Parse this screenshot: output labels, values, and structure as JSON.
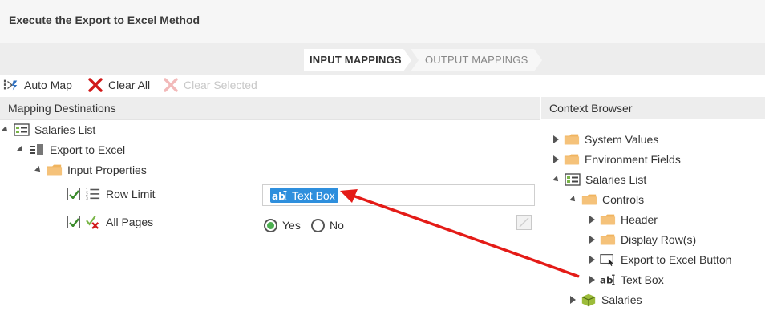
{
  "header": {
    "title": "Execute the Export to Excel Method"
  },
  "steps": [
    {
      "label": "INPUT MAPPINGS",
      "active": true
    },
    {
      "label": "OUTPUT MAPPINGS",
      "active": false
    }
  ],
  "toolbar": {
    "auto_map": "Auto Map",
    "clear_all": "Clear All",
    "clear_selected": "Clear Selected"
  },
  "mapping": {
    "heading": "Mapping Destinations",
    "root": "Salaries List",
    "method": "Export to Excel",
    "props_folder": "Input Properties",
    "row_limit": {
      "label": "Row Limit",
      "checked": true,
      "chip": "Text Box"
    },
    "all_pages": {
      "label": "All Pages",
      "checked": true,
      "yes": "Yes",
      "no": "No",
      "selected": "Yes"
    }
  },
  "context": {
    "heading": "Context Browser",
    "items": [
      {
        "label": "System Values",
        "icon": "folder-icon"
      },
      {
        "label": "Environment Fields",
        "icon": "folder-icon"
      },
      {
        "label": "Salaries List",
        "icon": "list-view-icon"
      },
      {
        "label": "Controls",
        "icon": "folder-icon"
      },
      {
        "label": "Header",
        "icon": "folder-icon"
      },
      {
        "label": "Display Row(s)",
        "icon": "folder-icon"
      },
      {
        "label": "Export to Excel Button",
        "icon": "button-icon"
      },
      {
        "label": "Text Box",
        "icon": "textbox-icon"
      },
      {
        "label": "Salaries",
        "icon": "smartobject-icon"
      }
    ]
  },
  "colors": {
    "accent": "#2e8fdd",
    "arrow": "#e41b17",
    "folder": "#f0b45e",
    "radio_on": "#4caf50"
  }
}
